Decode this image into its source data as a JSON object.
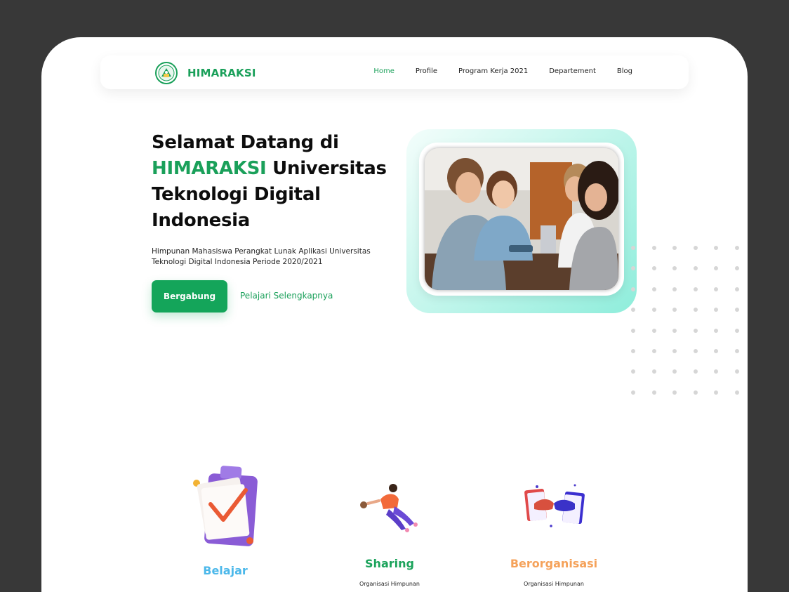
{
  "nav": {
    "brand": "HIMARAKSI",
    "links": [
      "Home",
      "Profile",
      "Program Kerja 2021",
      "Departement",
      "Blog"
    ],
    "active": "Home"
  },
  "hero": {
    "title_line1": "Selamat Datang di",
    "title_accent": "HIMARAKSI",
    "title_line2_rest": " Universitas",
    "title_line3": "Teknologi Digital",
    "title_line4": "Indonesia",
    "description": "Himpunan Mahasiswa Perangkat Lunak Aplikasi Universitas Teknologi Digital Indonesia Periode 2020/2021",
    "primary_button": "Bergabung",
    "secondary_link": "Pelajari Selengkapnya"
  },
  "features": [
    {
      "title": "Belajar",
      "text": "",
      "color": "#4cb8ea"
    },
    {
      "title": "Sharing",
      "text": "Organisasi Himpunan",
      "color": "#1ba35b"
    },
    {
      "title": "Berorganisasi",
      "text": "Organisasi Himpunan",
      "color": "#f5a25a"
    }
  ],
  "colors": {
    "brand_green": "#1aa05a",
    "button_green": "#14a55a",
    "background_outer": "#383838",
    "dot_grey": "#d6d6d6"
  },
  "icons": {
    "logo": "himaraksi-emblem-icon",
    "feature_illustrations": [
      "clipboard-check-icon",
      "flying-person-icon",
      "handshake-icon"
    ]
  }
}
